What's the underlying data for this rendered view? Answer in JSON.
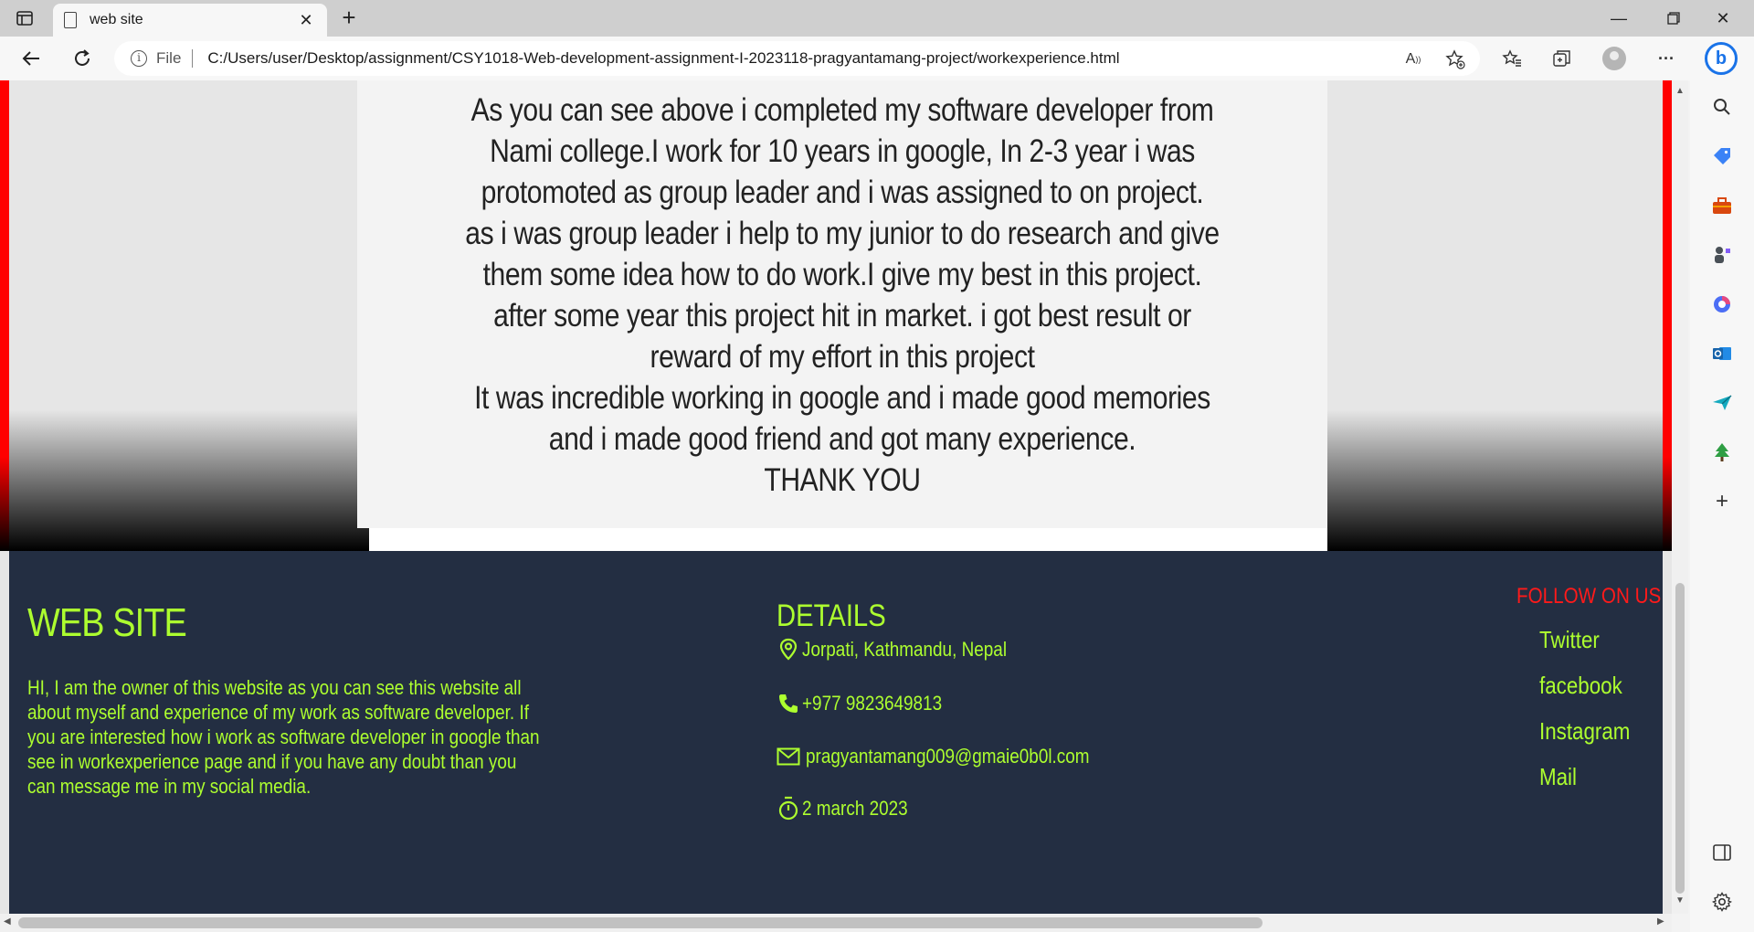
{
  "browser": {
    "tab_title": "web site",
    "new_tab": "+",
    "file_label": "File",
    "url": "C:/Users/user/Desktop/assignment/CSY1018-Web-development-assignment-I-2023118-pragyantamang-project/workexperience.html"
  },
  "icons": {
    "tab_actions": "tab-actions-icon",
    "back": "back-arrow-icon",
    "reload": "reload-icon",
    "info": "info-icon",
    "read_aloud": "read-aloud-icon",
    "add_favorite": "add-favorite-icon",
    "favorites": "favorites-icon",
    "collections": "collections-icon",
    "more": "more-icon",
    "bing": "bing-icon"
  },
  "content": {
    "paragraph_lines": [
      "As you can see above i completed my software developer from",
      "Nami college.I work for 10 years in google, In 2-3 year i was",
      "protomoted as group leader and i was assigned to on project.",
      "as i was group leader i help to my junior to do research and give",
      "them some idea how to do work.I give my best in this project.",
      "after some year this project hit in market. i got best result or",
      "reward of my effort in this project",
      "It was incredible working in google and i made good memories",
      "and i made good friend and got many experience.",
      "THANK YOU"
    ]
  },
  "footer": {
    "site_title": "WEB SITE",
    "description": "HI, I am the owner of this website as you can see this website all about myself and experience of my work as software developer. If you are interested how i work as software developer in google than see in workexperience page and if you have any doubt than you can message me in my social media.",
    "details_title": "DETAILS",
    "location": "Jorpati, Kathmandu, Nepal",
    "phone": "+977 9823649813",
    "email": "pragyantamang009@gmaie0b0l.com",
    "date": "2 march 2023",
    "follow_title": "FOLLOW ON US",
    "social_links": [
      "Twitter",
      "facebook",
      "Instagram",
      "Mail"
    ]
  },
  "colors": {
    "footer_bg": "#232e42",
    "accent_green": "#adff2f",
    "accent_red": "#ff1a1a",
    "side_border": "#ff0000"
  }
}
